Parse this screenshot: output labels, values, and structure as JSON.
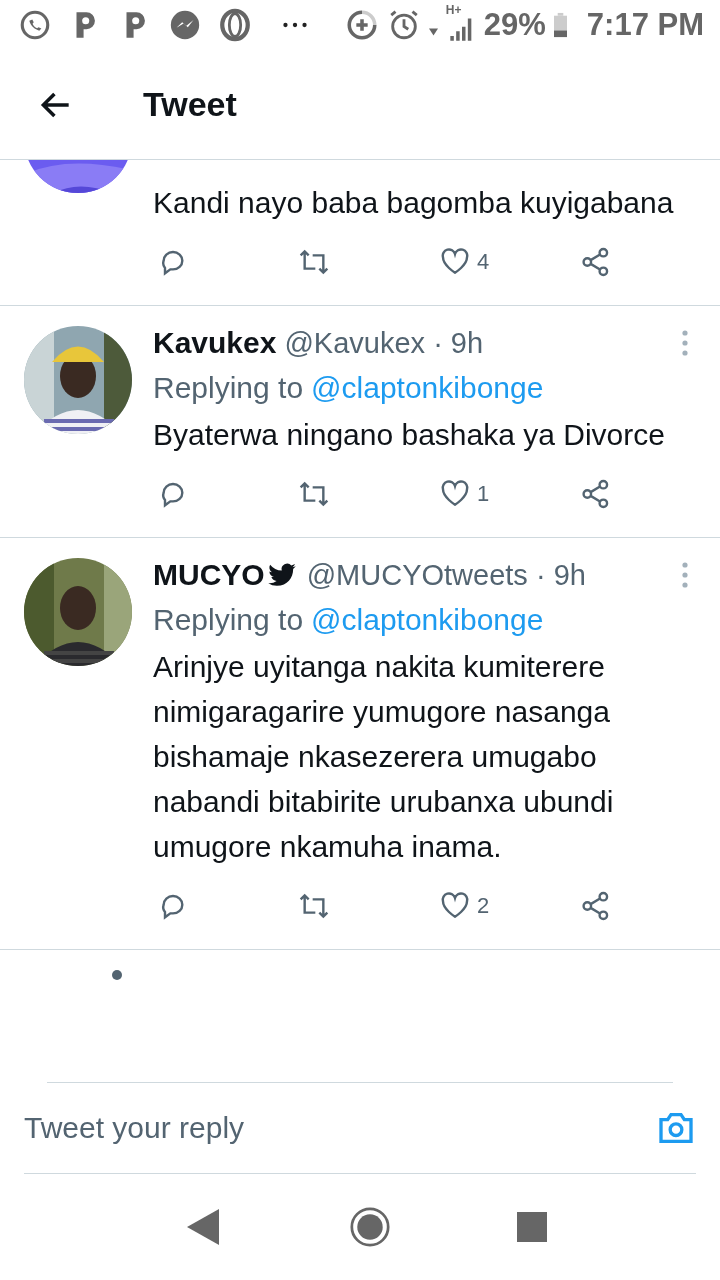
{
  "status_bar": {
    "network": "H+",
    "battery": "29%",
    "time": "7:17 PM"
  },
  "header": {
    "title": "Tweet"
  },
  "tweets": [
    {
      "kind": "partial",
      "text": "Kandi nayo baba bagomba kuyigabana",
      "likes": "4"
    },
    {
      "kind": "full",
      "name": "Kavukex",
      "bird_badge": false,
      "handle_time": "@Kavukex · 9h",
      "replying_label": "Replying to",
      "replying_to": "@claptonkibonge",
      "text": "Byaterwa ningano bashaka ya Divorce",
      "likes": "1"
    },
    {
      "kind": "full",
      "name": "MUCYO",
      "bird_badge": true,
      "handle_time": "@MUCYOtweets · 9h",
      "replying_label": "Replying to",
      "replying_to": "@claptonkibonge",
      "text": "Arinjye uyitanga nakita kumiterere nimigaragarire yumugore nasanga bishamaje nkasezerera umugabo nabandi bitabirite urubanxa ubundi umugore nkamuha inama.",
      "likes": "2"
    }
  ],
  "reply_box": {
    "placeholder": "Tweet your reply"
  }
}
